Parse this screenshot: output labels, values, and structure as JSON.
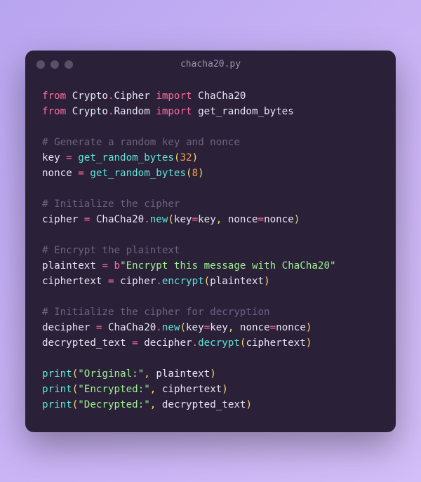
{
  "window": {
    "title": "chacha20.py"
  },
  "code": {
    "lines": [
      [
        {
          "cls": "kw",
          "t": "from"
        },
        {
          "cls": "id",
          "t": " Crypto"
        },
        {
          "cls": "op",
          "t": "."
        },
        {
          "cls": "id",
          "t": "Cipher "
        },
        {
          "cls": "kw",
          "t": "import"
        },
        {
          "cls": "id",
          "t": " ChaCha20"
        }
      ],
      [
        {
          "cls": "kw",
          "t": "from"
        },
        {
          "cls": "id",
          "t": " Crypto"
        },
        {
          "cls": "op",
          "t": "."
        },
        {
          "cls": "id",
          "t": "Random "
        },
        {
          "cls": "kw",
          "t": "import"
        },
        {
          "cls": "id",
          "t": " get_random_bytes"
        }
      ],
      [],
      [
        {
          "cls": "cm",
          "t": "# Generate a random key and nonce"
        }
      ],
      [
        {
          "cls": "id",
          "t": "key "
        },
        {
          "cls": "op",
          "t": "="
        },
        {
          "cls": "id",
          "t": " "
        },
        {
          "cls": "fn",
          "t": "get_random_bytes"
        },
        {
          "cls": "pn",
          "t": "("
        },
        {
          "cls": "num",
          "t": "32"
        },
        {
          "cls": "pn",
          "t": ")"
        }
      ],
      [
        {
          "cls": "id",
          "t": "nonce "
        },
        {
          "cls": "op",
          "t": "="
        },
        {
          "cls": "id",
          "t": " "
        },
        {
          "cls": "fn",
          "t": "get_random_bytes"
        },
        {
          "cls": "pn",
          "t": "("
        },
        {
          "cls": "num",
          "t": "8"
        },
        {
          "cls": "pn",
          "t": ")"
        }
      ],
      [],
      [
        {
          "cls": "cm",
          "t": "# Initialize the cipher"
        }
      ],
      [
        {
          "cls": "id",
          "t": "cipher "
        },
        {
          "cls": "op",
          "t": "="
        },
        {
          "cls": "id",
          "t": " ChaCha20"
        },
        {
          "cls": "op",
          "t": "."
        },
        {
          "cls": "fn",
          "t": "new"
        },
        {
          "cls": "pn",
          "t": "("
        },
        {
          "cls": "id",
          "t": "key"
        },
        {
          "cls": "op",
          "t": "="
        },
        {
          "cls": "id",
          "t": "key"
        },
        {
          "cls": "pn",
          "t": ", "
        },
        {
          "cls": "id",
          "t": "nonce"
        },
        {
          "cls": "op",
          "t": "="
        },
        {
          "cls": "id",
          "t": "nonce"
        },
        {
          "cls": "pn",
          "t": ")"
        }
      ],
      [],
      [
        {
          "cls": "cm",
          "t": "# Encrypt the plaintext"
        }
      ],
      [
        {
          "cls": "id",
          "t": "plaintext "
        },
        {
          "cls": "op",
          "t": "="
        },
        {
          "cls": "id",
          "t": " "
        },
        {
          "cls": "kw",
          "t": "b"
        },
        {
          "cls": "str",
          "t": "\"Encrypt this message with ChaCha20\""
        }
      ],
      [
        {
          "cls": "id",
          "t": "ciphertext "
        },
        {
          "cls": "op",
          "t": "="
        },
        {
          "cls": "id",
          "t": " cipher"
        },
        {
          "cls": "op",
          "t": "."
        },
        {
          "cls": "fn",
          "t": "encrypt"
        },
        {
          "cls": "pn",
          "t": "("
        },
        {
          "cls": "id",
          "t": "plaintext"
        },
        {
          "cls": "pn",
          "t": ")"
        }
      ],
      [],
      [
        {
          "cls": "cm",
          "t": "# Initialize the cipher for decryption"
        }
      ],
      [
        {
          "cls": "id",
          "t": "decipher "
        },
        {
          "cls": "op",
          "t": "="
        },
        {
          "cls": "id",
          "t": " ChaCha20"
        },
        {
          "cls": "op",
          "t": "."
        },
        {
          "cls": "fn",
          "t": "new"
        },
        {
          "cls": "pn",
          "t": "("
        },
        {
          "cls": "id",
          "t": "key"
        },
        {
          "cls": "op",
          "t": "="
        },
        {
          "cls": "id",
          "t": "key"
        },
        {
          "cls": "pn",
          "t": ", "
        },
        {
          "cls": "id",
          "t": "nonce"
        },
        {
          "cls": "op",
          "t": "="
        },
        {
          "cls": "id",
          "t": "nonce"
        },
        {
          "cls": "pn",
          "t": ")"
        }
      ],
      [
        {
          "cls": "id",
          "t": "decrypted_text "
        },
        {
          "cls": "op",
          "t": "="
        },
        {
          "cls": "id",
          "t": " decipher"
        },
        {
          "cls": "op",
          "t": "."
        },
        {
          "cls": "fn",
          "t": "decrypt"
        },
        {
          "cls": "pn",
          "t": "("
        },
        {
          "cls": "id",
          "t": "ciphertext"
        },
        {
          "cls": "pn",
          "t": ")"
        }
      ],
      [],
      [
        {
          "cls": "fn",
          "t": "print"
        },
        {
          "cls": "pn",
          "t": "("
        },
        {
          "cls": "str",
          "t": "\"Original:\""
        },
        {
          "cls": "pn",
          "t": ", "
        },
        {
          "cls": "id",
          "t": "plaintext"
        },
        {
          "cls": "pn",
          "t": ")"
        }
      ],
      [
        {
          "cls": "fn",
          "t": "print"
        },
        {
          "cls": "pn",
          "t": "("
        },
        {
          "cls": "str",
          "t": "\"Encrypted:\""
        },
        {
          "cls": "pn",
          "t": ", "
        },
        {
          "cls": "id",
          "t": "ciphertext"
        },
        {
          "cls": "pn",
          "t": ")"
        }
      ],
      [
        {
          "cls": "fn",
          "t": "print"
        },
        {
          "cls": "pn",
          "t": "("
        },
        {
          "cls": "str",
          "t": "\"Decrypted:\""
        },
        {
          "cls": "pn",
          "t": ", "
        },
        {
          "cls": "id",
          "t": "decrypted_text"
        },
        {
          "cls": "pn",
          "t": ")"
        }
      ]
    ]
  }
}
